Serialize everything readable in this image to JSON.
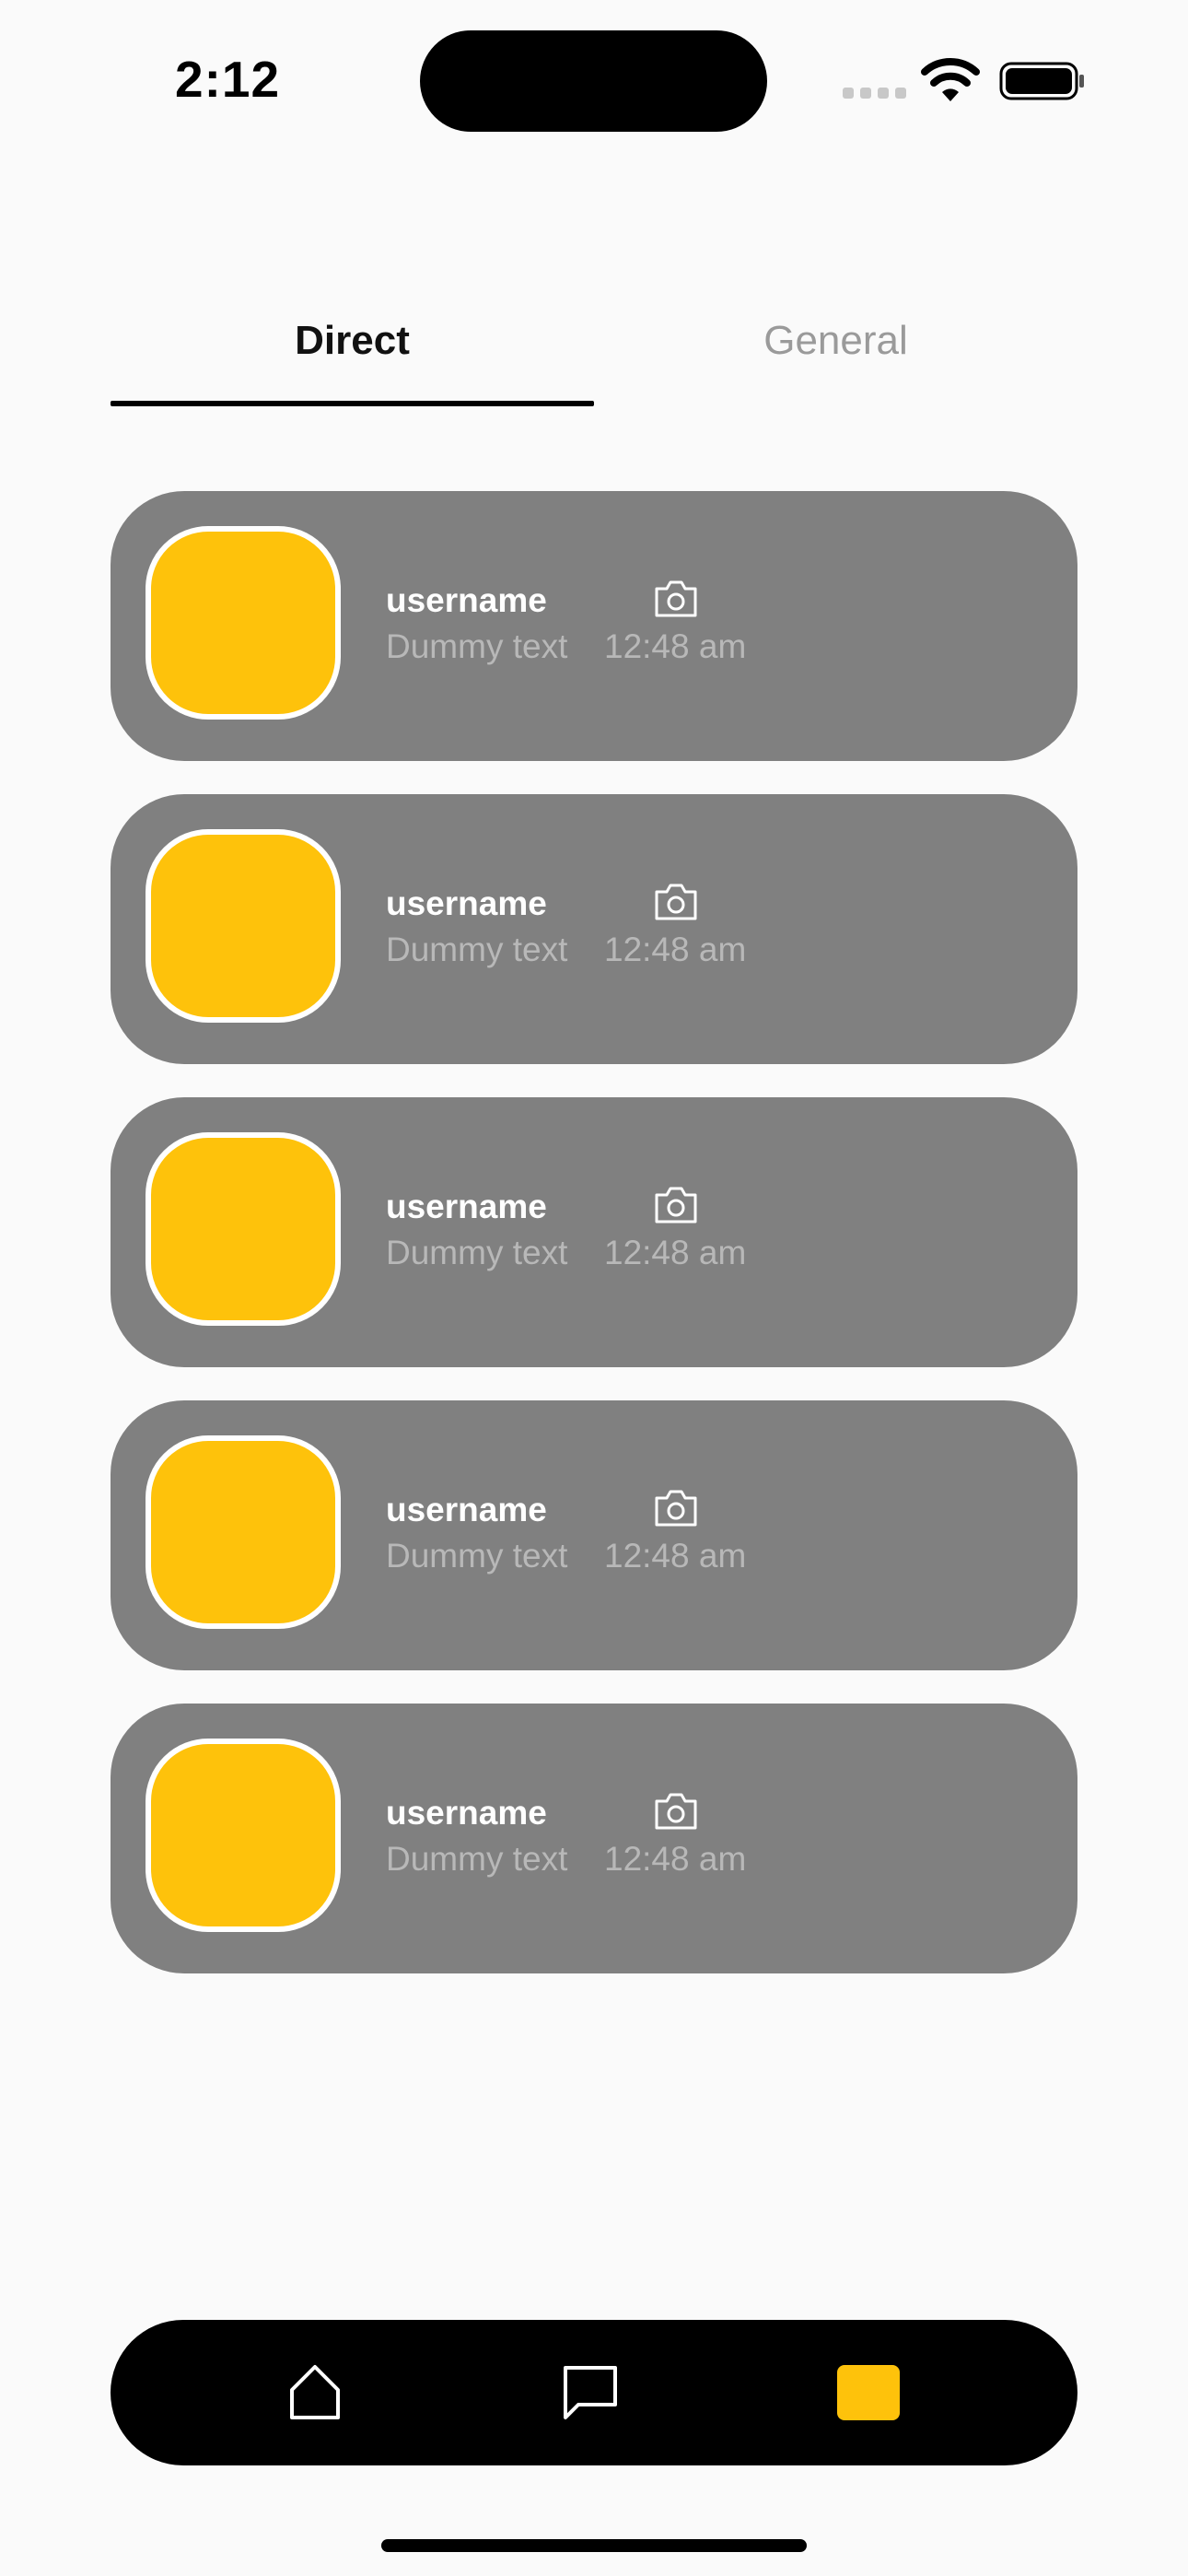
{
  "status_bar": {
    "time": "2:12"
  },
  "tabs": [
    {
      "label": "Direct",
      "active": true
    },
    {
      "label": "General",
      "active": false
    }
  ],
  "chats": [
    {
      "username": "username",
      "preview": "Dummy text",
      "time": "12:48 am"
    },
    {
      "username": "username",
      "preview": "Dummy text",
      "time": "12:48 am"
    },
    {
      "username": "username",
      "preview": "Dummy text",
      "time": "12:48 am"
    },
    {
      "username": "username",
      "preview": "Dummy text",
      "time": "12:48 am"
    },
    {
      "username": "username",
      "preview": "Dummy text",
      "time": "12:48 am"
    }
  ],
  "icons": {
    "chat_media": "camera-icon",
    "nav_home": "home-icon",
    "nav_chat": "chat-bubble-icon",
    "nav_profile": "profile-square-icon"
  },
  "colors": {
    "accent": "#fec20b",
    "card_background": "#808080",
    "nav_background": "#000000",
    "page_background": "#fafafa"
  }
}
